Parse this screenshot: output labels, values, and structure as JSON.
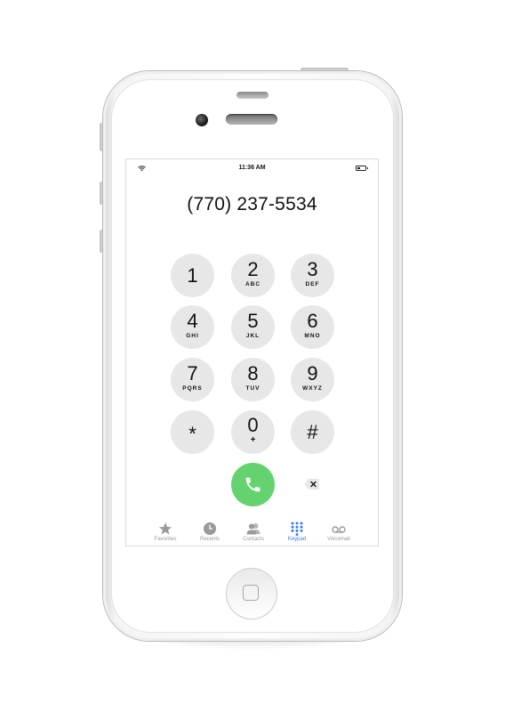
{
  "status_bar": {
    "time": "11:36 AM"
  },
  "dialer": {
    "number": "(770) 237-5534"
  },
  "keypad": {
    "keys": [
      {
        "digit": "1",
        "letters": ""
      },
      {
        "digit": "2",
        "letters": "ABC"
      },
      {
        "digit": "3",
        "letters": "DEF"
      },
      {
        "digit": "4",
        "letters": "GHI"
      },
      {
        "digit": "5",
        "letters": "JKL"
      },
      {
        "digit": "6",
        "letters": "MNO"
      },
      {
        "digit": "7",
        "letters": "PQRS"
      },
      {
        "digit": "8",
        "letters": "TUV"
      },
      {
        "digit": "9",
        "letters": "WXYZ"
      },
      {
        "digit": "*",
        "letters": ""
      },
      {
        "digit": "0",
        "letters": "+"
      },
      {
        "digit": "#",
        "letters": ""
      }
    ]
  },
  "colors": {
    "call_green": "#64d36f",
    "active_tab_blue": "#3a7cf0",
    "key_gray": "#e7e7e7",
    "inactive_tab_gray": "#9a9a9a"
  },
  "tabs": [
    {
      "label": "Favorites",
      "icon": "star-icon",
      "active": false
    },
    {
      "label": "Recents",
      "icon": "clock-icon",
      "active": false
    },
    {
      "label": "Contacts",
      "icon": "contacts-icon",
      "active": false
    },
    {
      "label": "Keypad",
      "icon": "keypad-icon",
      "active": true
    },
    {
      "label": "Voicemail",
      "icon": "voicemail-icon",
      "active": false
    }
  ]
}
